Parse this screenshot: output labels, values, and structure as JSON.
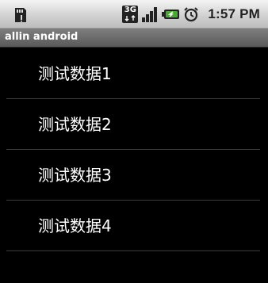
{
  "status_bar": {
    "left_icon": "sd-card-icon",
    "network_label": "3G",
    "icons": [
      "signal-icon",
      "battery-charging-icon",
      "alarm-clock-icon"
    ],
    "time": "1:57 PM"
  },
  "app": {
    "title": "allin android"
  },
  "list": {
    "items": [
      {
        "label": "测试数据1"
      },
      {
        "label": "测试数据2"
      },
      {
        "label": "测试数据3"
      },
      {
        "label": "测试数据4"
      }
    ]
  }
}
